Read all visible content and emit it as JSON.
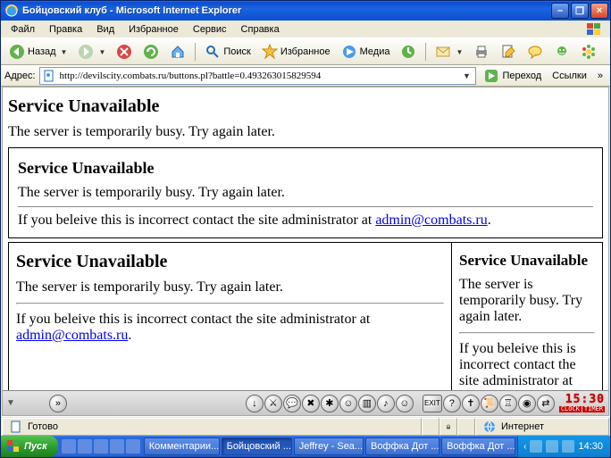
{
  "window": {
    "title": "Бойцовский клуб - Microsoft Internet Explorer"
  },
  "menus": {
    "file": "Файл",
    "edit": "Правка",
    "view": "Вид",
    "favorites": "Избранное",
    "tools": "Сервис",
    "help": "Справка"
  },
  "toolbar": {
    "back": "Назад",
    "search": "Поиск",
    "favorites": "Избранное",
    "media": "Медиа"
  },
  "address": {
    "label": "Адрес:",
    "url": "http://devilscity.combats.ru/buttons.pl?battle=0.493263015829594",
    "go": "Переход",
    "links": "Ссылки"
  },
  "page": {
    "h1": "Service Unavailable",
    "busy": "The server is temporarily busy. Try again later.",
    "frame": {
      "h": "Service Unavailable",
      "busy": "The server is temporarily busy. Try again later.",
      "contact_pre": "If you beleive this is incorrect contact the site administrator at ",
      "mail": "admin@combats.ru",
      "contact_post": "."
    },
    "left": {
      "h": "Service Unavailable",
      "busy": "The server is temporarily busy. Try again later.",
      "contact_pre": "If you beleive this is incorrect contact the site administrator at ",
      "mail": "admin@combats.ru",
      "contact_post": "."
    },
    "right": {
      "h": "Service Unavailable",
      "busy": "The server is temporarily busy. Try again later.",
      "contact": "If you beleive this is incorrect contact the site administrator at"
    }
  },
  "gamebar": {
    "clock_time": "15:30",
    "clock_l": "CLOCK",
    "clock_r": "TIMER"
  },
  "status": {
    "ready": "Готово",
    "zone": "Интернет"
  },
  "taskbar": {
    "start": "Пуск",
    "tasks": [
      {
        "label": "Комментарии..."
      },
      {
        "label": "Бойцовский ..."
      },
      {
        "label": "Jeffrey - Sea..."
      },
      {
        "label": "Воффка Дот ..."
      },
      {
        "label": "Воффка Дот ..."
      }
    ],
    "time": "14:30"
  }
}
